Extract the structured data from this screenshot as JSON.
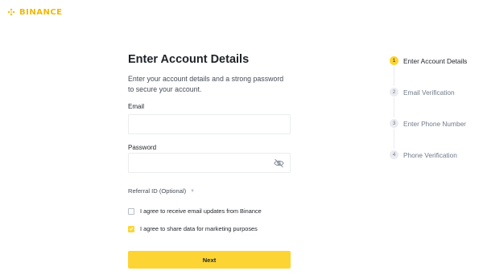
{
  "brand": {
    "name": "BINANCE",
    "color": "#F0B90B"
  },
  "form": {
    "title": "Enter Account Details",
    "subtitle": "Enter your account details and a strong password to secure your account.",
    "email_label": "Email",
    "email_value": "",
    "password_label": "Password",
    "password_value": "",
    "password_toggle_icon": "eye-off-icon",
    "referral_label": "Referral ID (Optional)",
    "referral_icon": "caret-down-icon",
    "checkboxes": [
      {
        "label": "I agree to receive email updates from Binance",
        "checked": false
      },
      {
        "label": "I agree to share data for marketing purposes",
        "checked": true
      }
    ],
    "submit_label": "Next"
  },
  "steps": [
    {
      "number": "1",
      "label": "Enter Account Details",
      "active": true
    },
    {
      "number": "2",
      "label": "Email Verification",
      "active": false
    },
    {
      "number": "3",
      "label": "Enter Phone Number",
      "active": false
    },
    {
      "number": "4",
      "label": "Phone Verification",
      "active": false
    }
  ],
  "colors": {
    "accent": "#FCD535",
    "border": "#EAECEF",
    "text": "#1E2329",
    "muted": "#707A8A"
  }
}
